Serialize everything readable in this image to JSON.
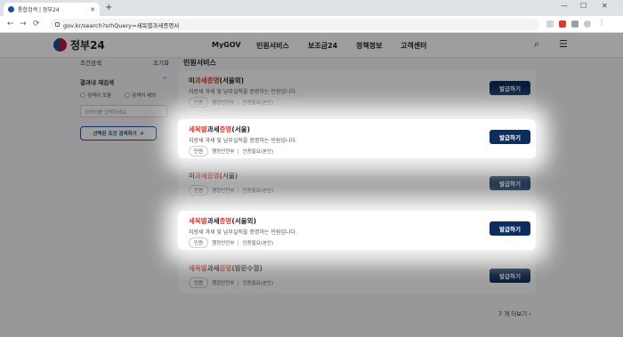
{
  "browser": {
    "tab_title": "통합검색 | 정부24",
    "tab_close": "✕",
    "new_tab": "+",
    "url": "gov.kr/search?srhQuery=세목별과세증명서",
    "win_min": "—",
    "win_max": "☐",
    "win_close": "✕",
    "back": "←",
    "forward": "→",
    "reload": "⟳"
  },
  "header": {
    "logo_text": "정부24",
    "nav": [
      "MyGOV",
      "민원서비스",
      "보조금24",
      "정책정보",
      "고객센터"
    ],
    "search_icon": "⌕",
    "menu_icon": "☰"
  },
  "filter": {
    "reset_label": "조건검색",
    "init_label": "초기화",
    "result_filter_label": "결과내 재검색",
    "include_label": "검색어 포함",
    "exclude_label": "검색어 제외",
    "input_placeholder": "검색어를 입력하세요.",
    "search_button_label": "선택된 조건 검색하기",
    "chevron": "^"
  },
  "results": {
    "section_title": "민원서비스",
    "issue_label": "발급하기",
    "dept": "행정안전부",
    "auth": "인증필요(본인)",
    "cards": [
      {
        "pre": "미",
        "hl": "과세증명",
        "post": "(서울외)",
        "desc": "지방세 과세 및 납부실적을 증명하는 민원입니다.",
        "pill": "민원"
      },
      {
        "pre": "",
        "hl": "세목별",
        "mid": "과세",
        "hl2": "증명",
        "post": "(서울)",
        "desc": "지방세 과세 및 납부실적을 증명하는 민원입니다.",
        "pill": "민원"
      },
      {
        "pre": "미",
        "hl": "과세증명",
        "post": "(서울)",
        "desc": "",
        "pill": "민원"
      },
      {
        "pre": "",
        "hl": "세목별",
        "mid": "과세",
        "hl2": "증명",
        "post": "(서울외)",
        "desc": "지방세 과세 및 납부실적을 증명하는 민원입니다.",
        "pill": "민원"
      },
      {
        "pre": "",
        "hl": "세목별",
        "mid": "과세",
        "hl2": "증명",
        "post": "(방문수령)",
        "desc": "",
        "pill": "민원"
      }
    ],
    "more_label": "7 개 더보기  ›"
  },
  "colors": {
    "accent": "#0b2e5c",
    "highlight": "#e0392b"
  }
}
